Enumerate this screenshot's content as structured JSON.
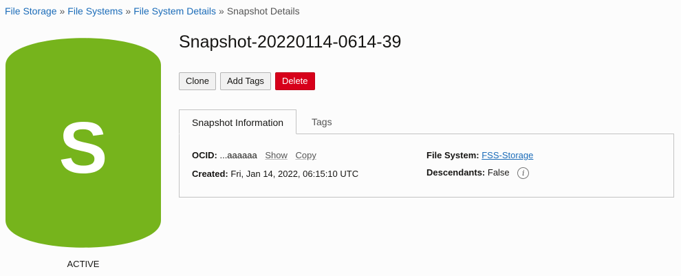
{
  "breadcrumb": {
    "items": [
      "File Storage",
      "File Systems",
      "File System Details"
    ],
    "separator": "»",
    "current": "Snapshot Details"
  },
  "resource": {
    "icon_letter": "S",
    "icon_color": "#76b41c",
    "status": "ACTIVE"
  },
  "title": "Snapshot-20220114-0614-39",
  "actions": {
    "clone_label": "Clone",
    "add_tags_label": "Add Tags",
    "delete_label": "Delete"
  },
  "tabs": [
    {
      "label": "Snapshot Information",
      "active": true
    },
    {
      "label": "Tags",
      "active": false
    }
  ],
  "info": {
    "ocid_label": "OCID:",
    "ocid_value": "...aaaaaa",
    "show_label": "Show",
    "copy_label": "Copy",
    "created_label": "Created:",
    "created_value": "Fri, Jan 14, 2022, 06:15:10 UTC",
    "file_system_label": "File System:",
    "file_system_value": "FSS-Storage",
    "descendants_label": "Descendants:",
    "descendants_value": "False",
    "info_icon_glyph": "i"
  }
}
